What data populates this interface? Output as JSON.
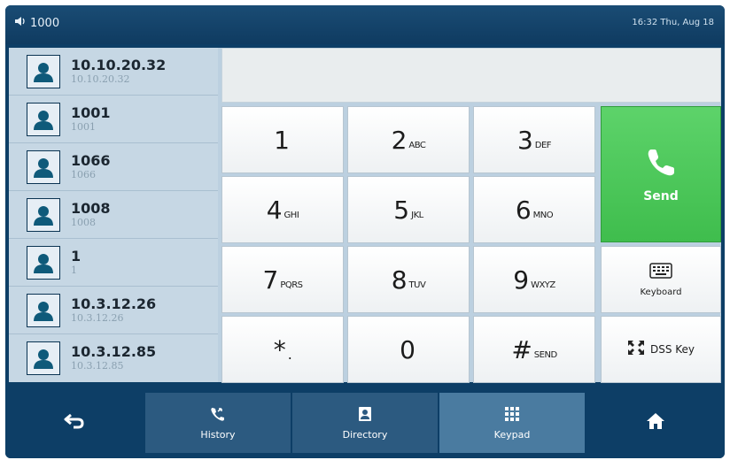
{
  "status": {
    "volume_icon": "speaker-icon",
    "account": "1000",
    "datetime": "16:32 Thu, Aug 18"
  },
  "contacts": [
    {
      "name": "10.10.20.32",
      "number": "10.10.20.32"
    },
    {
      "name": "1001",
      "number": "1001"
    },
    {
      "name": "1066",
      "number": "1066"
    },
    {
      "name": "1008",
      "number": "1008"
    },
    {
      "name": "1",
      "number": "1"
    },
    {
      "name": "10.3.12.26",
      "number": "10.3.12.26"
    },
    {
      "name": "10.3.12.85",
      "number": "10.3.12.85"
    }
  ],
  "dial_input": {
    "value": ""
  },
  "keypad": {
    "k1": {
      "digit": "1",
      "letters": ""
    },
    "k2": {
      "digit": "2",
      "letters": "ABC"
    },
    "k3": {
      "digit": "3",
      "letters": "DEF"
    },
    "k4": {
      "digit": "4",
      "letters": "GHI"
    },
    "k5": {
      "digit": "5",
      "letters": "JKL"
    },
    "k6": {
      "digit": "6",
      "letters": "MNO"
    },
    "k7": {
      "digit": "7",
      "letters": "PQRS"
    },
    "k8": {
      "digit": "8",
      "letters": "TUV"
    },
    "k9": {
      "digit": "9",
      "letters": "WXYZ"
    },
    "kstar": {
      "digit": "*",
      "letters": "."
    },
    "k0": {
      "digit": "0",
      "letters": ""
    },
    "khash": {
      "digit": "#",
      "letters": "SEND"
    }
  },
  "actions": {
    "send": "Send",
    "keyboard": "Keyboard",
    "dss_key": "DSS Key"
  },
  "nav": {
    "history": "History",
    "directory": "Directory",
    "keypad": "Keypad"
  },
  "colors": {
    "send_green": "#4cc65a",
    "nav_blue": "#0d3e66",
    "active_tab": "#4a7ba0"
  }
}
